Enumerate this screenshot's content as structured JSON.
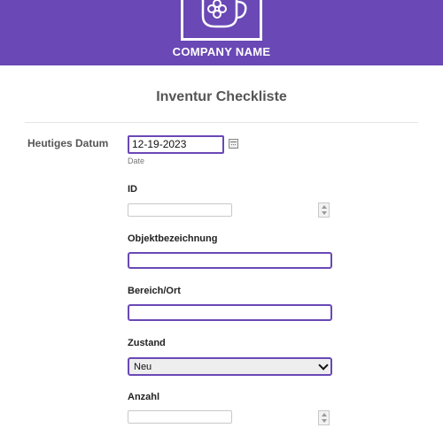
{
  "header": {
    "company_name": "COMPANY NAME",
    "background_color": "#6a48b5",
    "logo_icon": "mug-icon"
  },
  "form": {
    "title": "Inventur Checkliste",
    "date_field": {
      "label": "Heutiges Datum",
      "value": "12-19-2023",
      "sublabel": "Date",
      "icon": "calendar-icon"
    },
    "fields": [
      {
        "label": "ID",
        "type": "number",
        "value": ""
      },
      {
        "label": "Objektbezeichnung",
        "type": "text",
        "value": ""
      },
      {
        "label": "Bereich/Ort",
        "type": "text",
        "value": ""
      },
      {
        "label": "Zustand",
        "type": "select",
        "value": "Neu"
      },
      {
        "label": "Anzahl",
        "type": "number",
        "value": ""
      }
    ]
  },
  "colors": {
    "accent": "#6a48b5",
    "label_text": "#555555"
  }
}
